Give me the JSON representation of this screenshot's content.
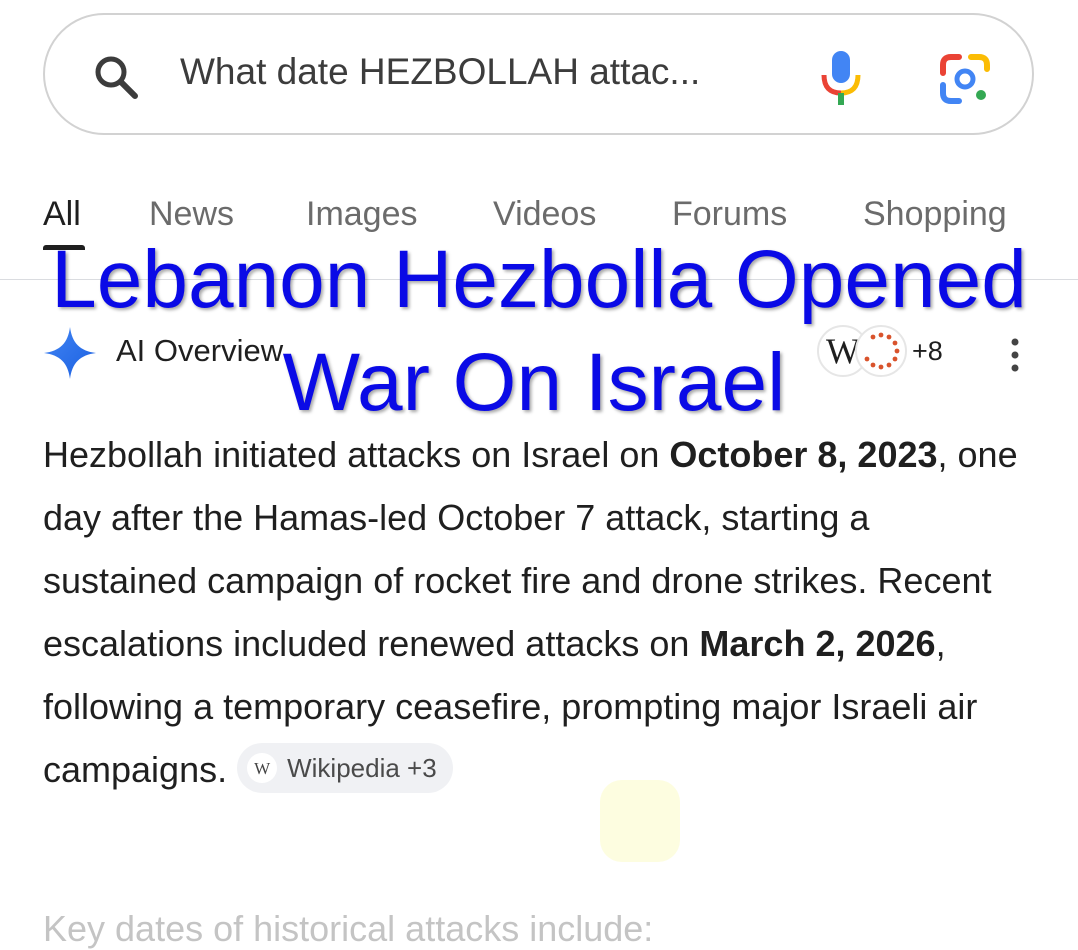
{
  "search": {
    "query": "What date HEZBOLLAH attac..."
  },
  "tabs": [
    {
      "label": "All",
      "active": true
    },
    {
      "label": "News"
    },
    {
      "label": "Images"
    },
    {
      "label": "Videos"
    },
    {
      "label": "Forums"
    },
    {
      "label": "Shopping"
    }
  ],
  "ai_overview": {
    "title": "AI Overview",
    "source_more": "+8",
    "text_parts": [
      "Hezbollah initiated attacks on Israel on ",
      "October 8, 2023",
      ", one day after the Hamas-led October 7 attack, starting a sustained campaign of rocket fire and drone strikes. Recent escalations included renewed attacks on ",
      "March 2, 2026",
      ", following a temporary ceasefire, prompting major Israeli air campaigns."
    ],
    "chip_icon": "W",
    "chip_label": "Wikipedia +3",
    "subheading": "Key dates of historical attacks include:"
  },
  "overlay": {
    "line1": "Lebanon Hezbolla Opened",
    "line2": "War On Israel"
  },
  "colors": {
    "overlay_text": "#0a0ae6",
    "google_blue": "#4285F4",
    "google_red": "#EA4335",
    "google_yellow": "#FBBC04",
    "google_green": "#34A853"
  },
  "icons": [
    "search-icon",
    "mic-icon",
    "lens-icon",
    "ai-sparkle-icon",
    "wikipedia-icon",
    "kebab-menu-icon"
  ]
}
